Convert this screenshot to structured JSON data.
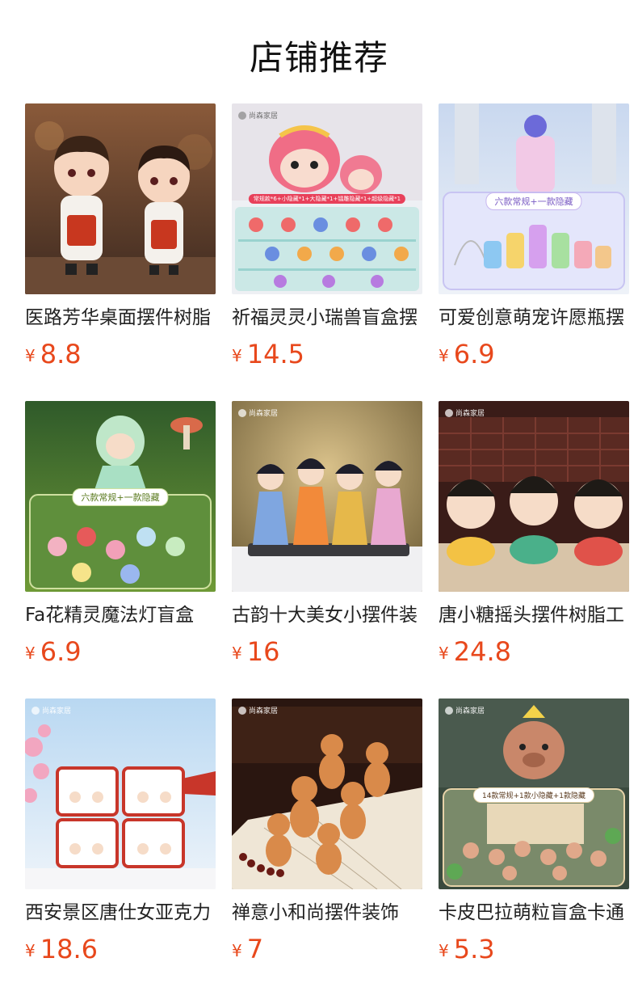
{
  "header": {
    "title": "店铺推荐"
  },
  "products": [
    {
      "name": "医路芳华桌面摆件树脂",
      "currency": "¥",
      "price": "8.8",
      "image": "doctor-nurse-figurines"
    },
    {
      "name": "祈福灵灵小瑞兽盲盒摆",
      "currency": "¥",
      "price": "14.5",
      "image": "lion-dance-blind-box",
      "banner": "常规款*6+小隐藏*1+大隐藏*1+镭雕隐藏*1+超级隐藏*1",
      "brand": "尚森家居"
    },
    {
      "name": "可爱创意萌宠许愿瓶摆",
      "currency": "¥",
      "price": "6.9",
      "image": "wish-bottle-figurines",
      "banner": "六款常规+一款隐藏"
    },
    {
      "name": "Fa花精灵魔法灯盲盒",
      "currency": "¥",
      "price": "6.9",
      "image": "flower-elf-lamp",
      "banner": "六款常规+一款隐藏"
    },
    {
      "name": "古韵十大美女小摆件装",
      "currency": "¥",
      "price": "16",
      "image": "ancient-beauty-figurines",
      "brand": "尚森家居"
    },
    {
      "name": "唐小糖摇头摆件树脂工",
      "currency": "¥",
      "price": "24.8",
      "image": "tang-dynasty-girls",
      "brand": "尚森家居"
    },
    {
      "name": "西安景区唐仕女亚克力",
      "currency": "¥",
      "price": "18.6",
      "image": "tang-ladies-acrylic",
      "brand": "尚森家居"
    },
    {
      "name": "禅意小和尚摆件装饰",
      "currency": "¥",
      "price": "7",
      "image": "zen-monk-figurines",
      "brand": "尚森家居"
    },
    {
      "name": "卡皮巴拉萌粒盲盒卡通",
      "currency": "¥",
      "price": "5.3",
      "image": "capybara-blind-box",
      "banner": "14款常规+1款小隐藏+1款隐藏",
      "brand": "尚森家居"
    }
  ]
}
